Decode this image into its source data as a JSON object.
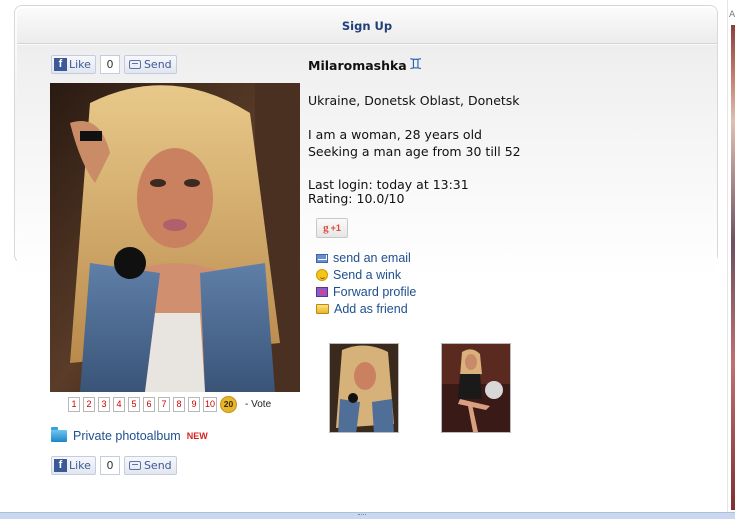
{
  "header": {
    "signup_label": "Sign Up"
  },
  "facebook": {
    "like_label": "Like",
    "like_count": "0",
    "send_label": "Send",
    "logo_glyph": "f"
  },
  "profile": {
    "name": "Milaromashka",
    "zodiac_symbol": "♊",
    "location": "Ukraine, Donetsk Oblast, Donetsk",
    "about_line1": "I am a woman, 28 years old",
    "about_line2": "Seeking a man age from 30 till 52",
    "last_login": "Last login: today at 13:31",
    "rating": "Rating: 10.0/10"
  },
  "gplus": {
    "g": "g",
    "plus_one": "+1"
  },
  "actions": [
    {
      "label": "send an email",
      "icon": "envelope-icon"
    },
    {
      "label": "Send a wink",
      "icon": "smiley-icon"
    },
    {
      "label": "Forward profile",
      "icon": "forward-heart-icon"
    },
    {
      "label": "Add as friend",
      "icon": "folder-icon"
    }
  ],
  "vote": {
    "options": [
      "1",
      "2",
      "3",
      "4",
      "5",
      "6",
      "7",
      "8",
      "9",
      "10"
    ],
    "selected": "20",
    "label": "- Vote"
  },
  "private_album": {
    "label": "Private photoalbum",
    "badge": "NEW"
  },
  "right_strip_letter": "A",
  "colors": {
    "link": "#1f4f8f",
    "title_link": "#1f3f77",
    "accent_red": "#d62020",
    "vote_active": "#e8b62a",
    "facebook": "#3b5998"
  }
}
